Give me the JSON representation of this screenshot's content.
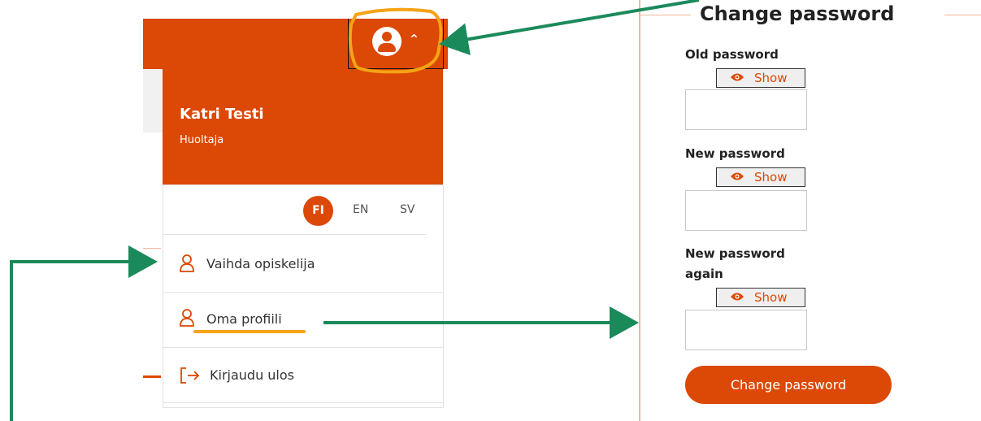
{
  "header": {
    "avatar_icon": "user-circle-icon",
    "chevron_icon": "chevron-up-icon"
  },
  "profile": {
    "name": "Katri Testi",
    "role": "Huoltaja"
  },
  "languages": {
    "fi": "FI",
    "en": "EN",
    "sv": "SV",
    "active": "FI"
  },
  "menu": {
    "items": [
      {
        "label": "Vaihda opiskelija",
        "icon": "person-outline-icon"
      },
      {
        "label": "Oma profiili",
        "icon": "person-outline-icon"
      },
      {
        "label": "Kirjaudu ulos",
        "icon": "logout-icon"
      }
    ]
  },
  "form": {
    "title": "Change password",
    "old_label": "Old password",
    "new_label": "New password",
    "new_again_label_line1": "New password",
    "new_again_label_line2": "again",
    "show_label": "Show",
    "submit_label": "Change password"
  },
  "colors": {
    "brand": "#dc4805",
    "annotation_green": "#1b8a5a",
    "annotation_orange": "#f5a314"
  }
}
